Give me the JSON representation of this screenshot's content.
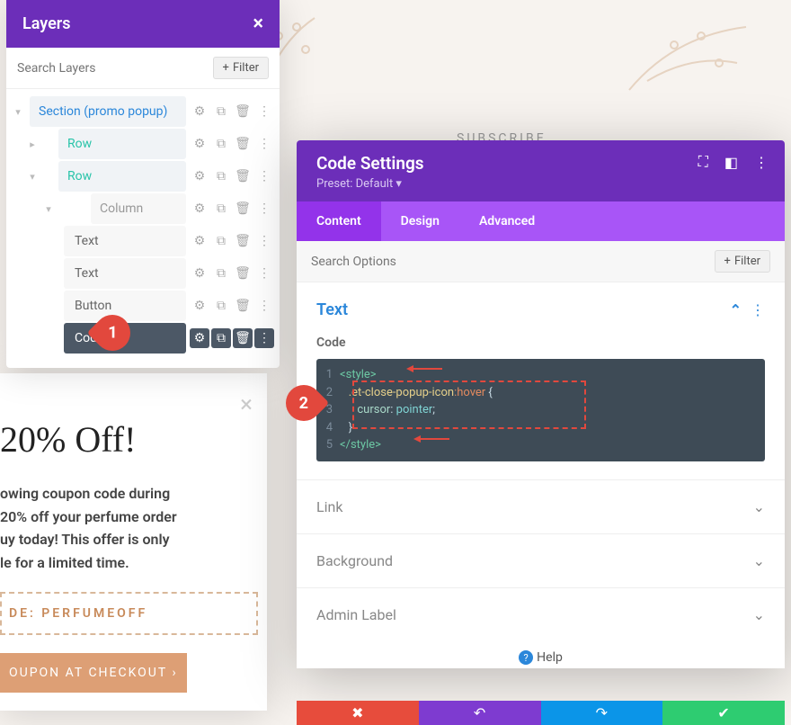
{
  "layers": {
    "title": "Layers",
    "search_placeholder": "Search Layers",
    "filter_label": "Filter",
    "tree": {
      "section": "Section (promo popup)",
      "row1": "Row",
      "row2": "Row",
      "column": "Column",
      "text1": "Text",
      "text2": "Text",
      "button": "Button",
      "code": "Code"
    }
  },
  "popup": {
    "heading": "20% Off!",
    "body_l1": "owing coupon code during",
    "body_l2": "20% off your perfume order",
    "body_l3": "uy today! This offer is only",
    "body_l4": "le for a limited time.",
    "coupon": "DE: PERFUMEOFF",
    "cta": "OUPON AT CHECKOUT  ›"
  },
  "subscribe": "SUBSCRIBE",
  "modal": {
    "title": "Code Settings",
    "preset": "Preset: Default ▾",
    "tabs": {
      "content": "Content",
      "design": "Design",
      "advanced": "Advanced"
    },
    "search_placeholder": "Search Options",
    "filter_label": "Filter",
    "section_text": "Text",
    "code_label": "Code",
    "code": {
      "l1": "<style>",
      "l2_sel": ".et-close-popup-icon",
      "l2_pseudo": ":hover",
      "l2_brace": " {",
      "l3_prop": "cursor",
      "l3_val": "pointer",
      "l4": "}",
      "l5": "</style>"
    },
    "acc": {
      "link": "Link",
      "background": "Background",
      "admin": "Admin Label"
    },
    "help": "Help"
  },
  "callouts": {
    "one": "1",
    "two": "2"
  }
}
